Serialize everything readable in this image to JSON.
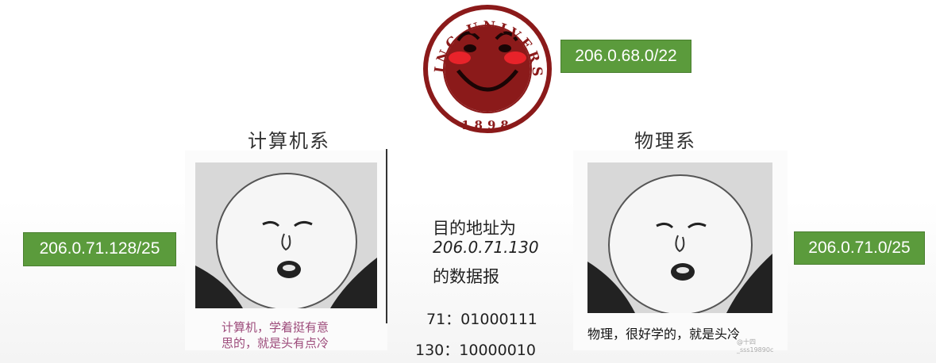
{
  "logo": {
    "top_text": "PEKING UNIVERSITY",
    "year": "1898",
    "colors": {
      "maroon": "#8b1a1a",
      "cheek": "#e8232a"
    }
  },
  "subnets": {
    "university": "206.0.68.0/22",
    "cs_department": "206.0.71.128/25",
    "physics_department": "206.0.71.0/25"
  },
  "departments": {
    "cs": {
      "title": "计算机系",
      "caption_line1": "计算机，学着挺有意",
      "caption_line2": "思的，就是头有点冷"
    },
    "physics": {
      "title": "物理系",
      "caption": "物理，很好学的，就是头冷",
      "watermark": "@十四_sss19890c"
    }
  },
  "center": {
    "line1": "目的地址为",
    "line2": "206.0.71.130",
    "line3": "的数据报",
    "bits_71": "71：01000111",
    "bits_130": "130：10000010"
  },
  "colors": {
    "green_box": "#5b9b3c",
    "caption_pink": "#9c4a7a"
  }
}
